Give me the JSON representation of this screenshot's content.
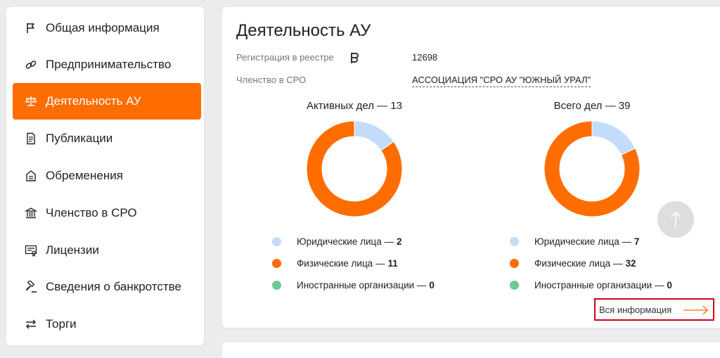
{
  "sidebar": {
    "items": [
      {
        "label": "Общая информация",
        "icon": "flag-icon"
      },
      {
        "label": "Предпринимательство",
        "icon": "link-icon"
      },
      {
        "label": "Деятельность АУ",
        "icon": "scales-icon",
        "active": true
      },
      {
        "label": "Публикации",
        "icon": "document-icon"
      },
      {
        "label": "Обременения",
        "icon": "archive-box-icon"
      },
      {
        "label": "Членство в СРО",
        "icon": "institution-icon"
      },
      {
        "label": "Лицензии",
        "icon": "certificate-icon"
      },
      {
        "label": "Сведения о банкротстве",
        "icon": "gavel-icon"
      },
      {
        "label": "Торги",
        "icon": "swap-arrows-icon"
      }
    ]
  },
  "main": {
    "title": "Деятельность АУ",
    "registration_label": "Регистрация в реестре",
    "registration_value": "12698",
    "sro_label": "Членство в СРО",
    "sro_value": "АССОЦИАЦИЯ \"СРО АУ \"ЮЖНЫЙ УРАЛ\"",
    "all_info_label": "Вся информация"
  },
  "colors": {
    "accent": "#ff6d00",
    "legal_entities": "#c3dcfa",
    "individuals": "#ff6d00",
    "foreign": "#6cca8e",
    "highlight_border": "#d0021b"
  },
  "chart_data": [
    {
      "type": "pie",
      "title": "Активных дел — 13",
      "categories": [
        "Юридические лица",
        "Физические лица",
        "Иностранные организации"
      ],
      "values": [
        2,
        11,
        0
      ],
      "legend_labels": [
        "Юридические лица —",
        "Физические лица —",
        "Иностранные организации —"
      ]
    },
    {
      "type": "pie",
      "title": "Всего дел — 39",
      "categories": [
        "Юридические лица",
        "Физические лица",
        "Иностранные организации"
      ],
      "values": [
        7,
        32,
        0
      ],
      "legend_labels": [
        "Юридические лица —",
        "Физические лица —",
        "Иностранные организации —"
      ]
    }
  ]
}
